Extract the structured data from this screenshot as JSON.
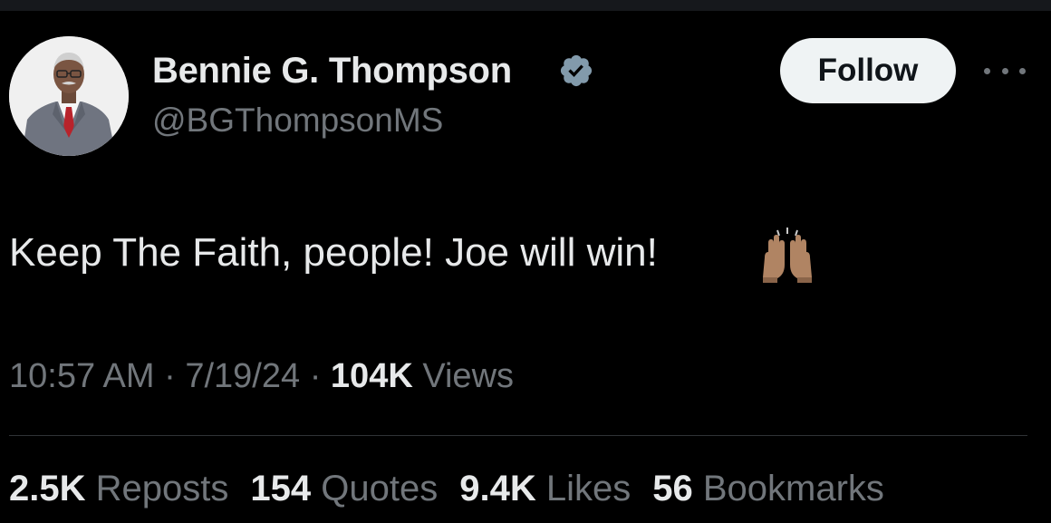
{
  "author": {
    "name": "Bennie G. Thompson",
    "handle": "@BGThompsonMS",
    "verified": true,
    "avatar": "portrait-photo"
  },
  "follow_label": "Follow",
  "more_icon": "more-options-icon",
  "tweet": {
    "text": "Keep The Faith, people! Joe will win!",
    "emoji": "raising-hands-emoji"
  },
  "meta": {
    "time": "10:57 AM",
    "date": "7/19/24",
    "separator": "·",
    "views_count": "104K",
    "views_label": "Views"
  },
  "stats": {
    "reposts": {
      "count": "2.5K",
      "label": "Reposts"
    },
    "quotes": {
      "count": "154",
      "label": "Quotes"
    },
    "likes": {
      "count": "9.4K",
      "label": "Likes"
    },
    "bookmarks": {
      "count": "56",
      "label": "Bookmarks"
    }
  },
  "colors": {
    "background": "#000000",
    "primary_text": "#e7e9ea",
    "secondary_text": "#71767b",
    "verified_badge": "#829aab",
    "follow_bg": "#eff3f4",
    "divider": "#2f3336"
  }
}
